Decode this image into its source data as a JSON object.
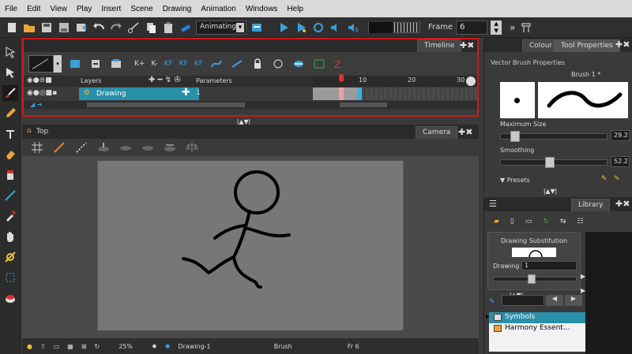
{
  "menu": [
    "File",
    "Edit",
    "View",
    "Play",
    "Insert",
    "Scene",
    "Drawing",
    "Animation",
    "Windows",
    "Help"
  ],
  "toolbar": {
    "mode_value": "Animating",
    "frame_label": "Frame",
    "frame_value": "6",
    "more": "»"
  },
  "timeline": {
    "tab_label": "Timeline",
    "layers_header": "Layers",
    "parameters_header": "Parameters",
    "layer_name": "Drawing",
    "layer_param": "1",
    "ruler": [
      "10",
      "20",
      "30"
    ],
    "tool_labels": [
      "K+",
      "K-",
      "KF",
      "KF",
      "KF"
    ]
  },
  "view": {
    "top_label": "Top",
    "camera_tab": "Camera",
    "zoom": "25%",
    "drawing_name": "Drawing-1",
    "tool": "Brush",
    "frame": "Fr 6"
  },
  "toolprops": {
    "tab_colour": "Colour",
    "tab_tool": "Tool Properties",
    "section": "Vector Brush Properties",
    "preset_name": "Brush 1 *",
    "max_size_label": "Maximum Size",
    "max_size_value": "29.2",
    "max_size_fraction": 0.1,
    "smoothing_label": "Smoothing",
    "smoothing_value": "52.2",
    "smoothing_fraction": 0.45,
    "presets_label": "Presets"
  },
  "library": {
    "tab": "Library",
    "drawsub_title": "Drawing Substitution",
    "drawing_label": "Drawing",
    "drawing_value": "1",
    "drawing_fraction": 0.45,
    "tree": [
      "Symbols",
      "Harmony Essent..."
    ]
  },
  "colors": {
    "accent_teal": "#2a8fa8",
    "timeline_border": "#d01818"
  }
}
